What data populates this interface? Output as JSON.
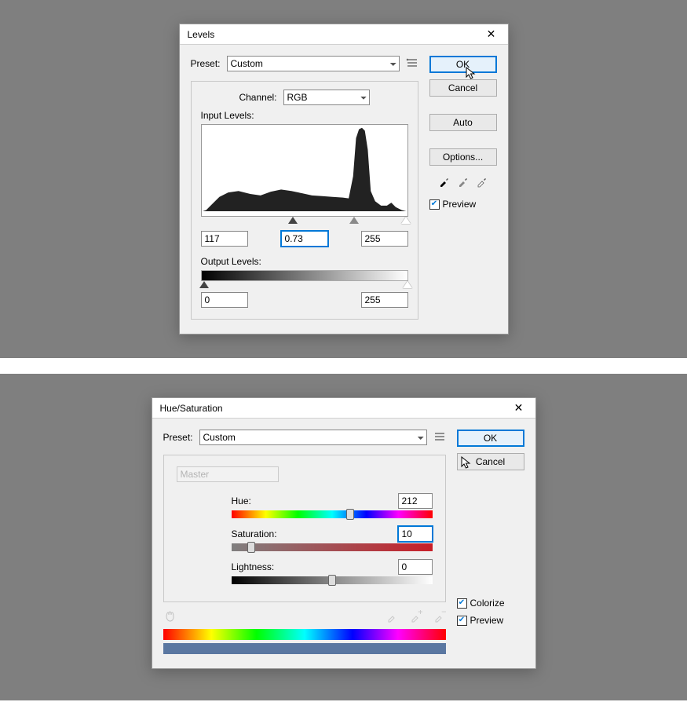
{
  "levels": {
    "title": "Levels",
    "preset_label": "Preset:",
    "preset_value": "Custom",
    "channel_label": "Channel:",
    "channel_value": "RGB",
    "input_levels_label": "Input Levels:",
    "input_black": "117",
    "input_gamma": "0.73",
    "input_white": "255",
    "output_levels_label": "Output Levels:",
    "output_black": "0",
    "output_white": "255",
    "ok": "OK",
    "cancel": "Cancel",
    "auto": "Auto",
    "options": "Options...",
    "preview": "Preview",
    "preview_checked": true
  },
  "hue": {
    "title": "Hue/Saturation",
    "preset_label": "Preset:",
    "preset_value": "Custom",
    "range_value": "Master",
    "hue_label": "Hue:",
    "hue_value": "212",
    "sat_label": "Saturation:",
    "sat_value": "10",
    "lig_label": "Lightness:",
    "lig_value": "0",
    "ok": "OK",
    "cancel": "Cancel",
    "colorize": "Colorize",
    "colorize_checked": true,
    "preview": "Preview",
    "preview_checked": true
  }
}
